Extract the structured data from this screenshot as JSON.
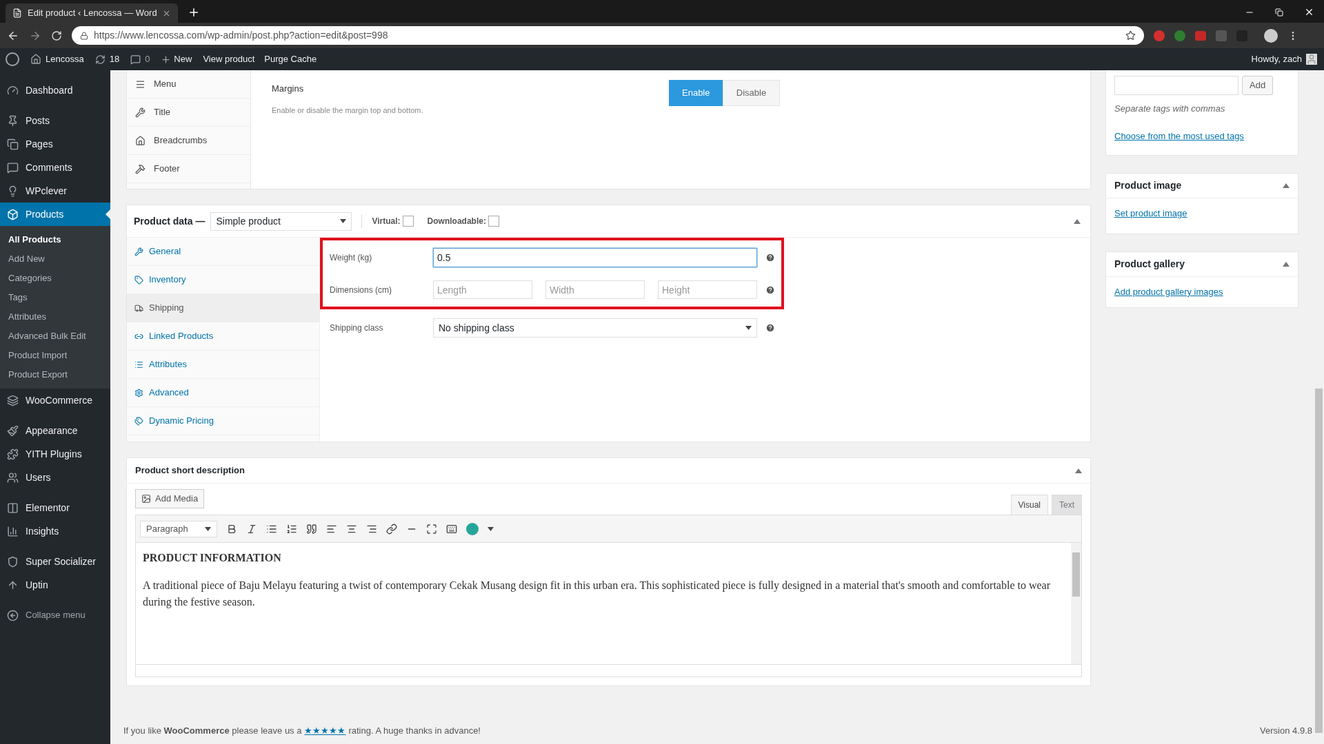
{
  "browser": {
    "tab_title": "Edit product ‹ Lencossa — Word",
    "url": "https://www.lencossa.com/wp-admin/post.php?action=edit&post=998"
  },
  "admin_bar": {
    "site": "Lencossa",
    "updates": "18",
    "comments": "0",
    "new": "New",
    "view": "View product",
    "purge": "Purge Cache",
    "greeting": "Howdy, zach"
  },
  "sidebar": {
    "sections": [
      [
        {
          "label": "Dashboard",
          "selected": false
        }
      ],
      [
        {
          "label": "Posts",
          "selected": false
        },
        {
          "label": "Pages",
          "selected": false
        },
        {
          "label": "Comments",
          "selected": false
        },
        {
          "label": "WPclever",
          "selected": false
        },
        {
          "label": "Products",
          "selected": true,
          "children": [
            {
              "label": "All Products",
              "selected": true
            },
            {
              "label": "Add New",
              "selected": false
            },
            {
              "label": "Categories",
              "selected": false
            },
            {
              "label": "Tags",
              "selected": false
            },
            {
              "label": "Attributes",
              "selected": false
            },
            {
              "label": "Advanced Bulk Edit",
              "selected": false
            },
            {
              "label": "Product Import",
              "selected": false
            },
            {
              "label": "Product Export",
              "selected": false
            }
          ]
        },
        {
          "label": "WooCommerce",
          "selected": false
        }
      ],
      [
        {
          "label": "Appearance",
          "selected": false
        },
        {
          "label": "YITH Plugins",
          "selected": false
        },
        {
          "label": "Users",
          "selected": false
        }
      ],
      [
        {
          "label": "Elementor",
          "selected": false
        },
        {
          "label": "Insights",
          "selected": false
        }
      ],
      [
        {
          "label": "Super Socializer",
          "selected": false
        },
        {
          "label": "Uptin",
          "selected": false
        }
      ]
    ],
    "collapse": "Collapse menu"
  },
  "settings_panel": {
    "nav": [
      {
        "label": "Menu"
      },
      {
        "label": "Title"
      },
      {
        "label": "Breadcrumbs"
      },
      {
        "label": "Footer"
      }
    ],
    "option": {
      "title": "Margins",
      "description": "Enable or disable the margin top and bottom.",
      "buttons": [
        {
          "label": "Enable",
          "selected": true
        },
        {
          "label": "Disable",
          "selected": false
        }
      ]
    }
  },
  "product_data": {
    "title": "Product data —",
    "type": "Simple product",
    "virtual": {
      "label": "Virtual:",
      "checked": false
    },
    "downloadable": {
      "label": "Downloadable:",
      "checked": false
    },
    "tabs": [
      {
        "label": "General",
        "selected": false
      },
      {
        "label": "Inventory",
        "selected": false
      },
      {
        "label": "Shipping",
        "selected": true
      },
      {
        "label": "Linked Products",
        "selected": false
      },
      {
        "label": "Attributes",
        "selected": false
      },
      {
        "label": "Advanced",
        "selected": false
      },
      {
        "label": "Dynamic Pricing",
        "selected": false
      }
    ],
    "weight": {
      "label": "Weight (kg)",
      "value": "0.5"
    },
    "dimensions": {
      "label": "Dimensions (cm)",
      "placeholders": [
        "Length",
        "Width",
        "Height"
      ]
    },
    "shipping_class": {
      "label": "Shipping class",
      "value": "No shipping class"
    }
  },
  "short_description": {
    "title": "Product short description",
    "add_media": "Add Media",
    "modes": [
      {
        "label": "Visual",
        "selected": true
      },
      {
        "label": "Text",
        "selected": false
      }
    ],
    "format": "Paragraph",
    "heading": "PRODUCT INFORMATION",
    "body": "A traditional piece of Baju Melayu featuring a twist of contemporary Cekak Musang design fit in this urban era. This sophisticated piece is fully designed in a material that's smooth and comfortable to wear during the festive season."
  },
  "tags_box": {
    "button": "Add",
    "hint": "Separate tags with commas",
    "link": "Choose from the most used tags"
  },
  "product_image": {
    "title": "Product image",
    "link": "Set product image"
  },
  "product_gallery": {
    "title": "Product gallery",
    "link": "Add product gallery images"
  },
  "footer": {
    "text": "If you like **WooCommerce** please leave us a",
    "stars": "★★★★★",
    "after": "rating. A huge thanks in advance!",
    "version": "Version 4.9.8"
  }
}
